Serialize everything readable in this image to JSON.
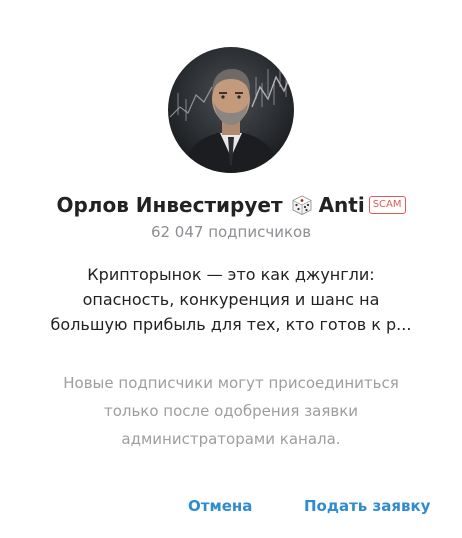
{
  "channel": {
    "title": "Орлов Инвестирует",
    "title_suffix": "Anti",
    "title_icon": "dice-icon",
    "badge": "SCAM",
    "subscribers": "62 047 подписчиков",
    "avatar": "avatar-photo"
  },
  "description": {
    "line1": "Крипторынок — это как джунгли:",
    "line2": "опасность, конкуренция и шанс на",
    "line3": "большую прибыль для тех, кто готов к р..."
  },
  "notice": {
    "line1": "Новые подписчики могут присоединиться",
    "line2": "только после одобрения заявки",
    "line3": "администраторами канала."
  },
  "buttons": {
    "cancel": "Отмена",
    "apply": "Подать заявку"
  },
  "colors": {
    "accent": "#2f8ccf",
    "scam": "#e25a5a",
    "secondary_text": "#8e8e93"
  }
}
